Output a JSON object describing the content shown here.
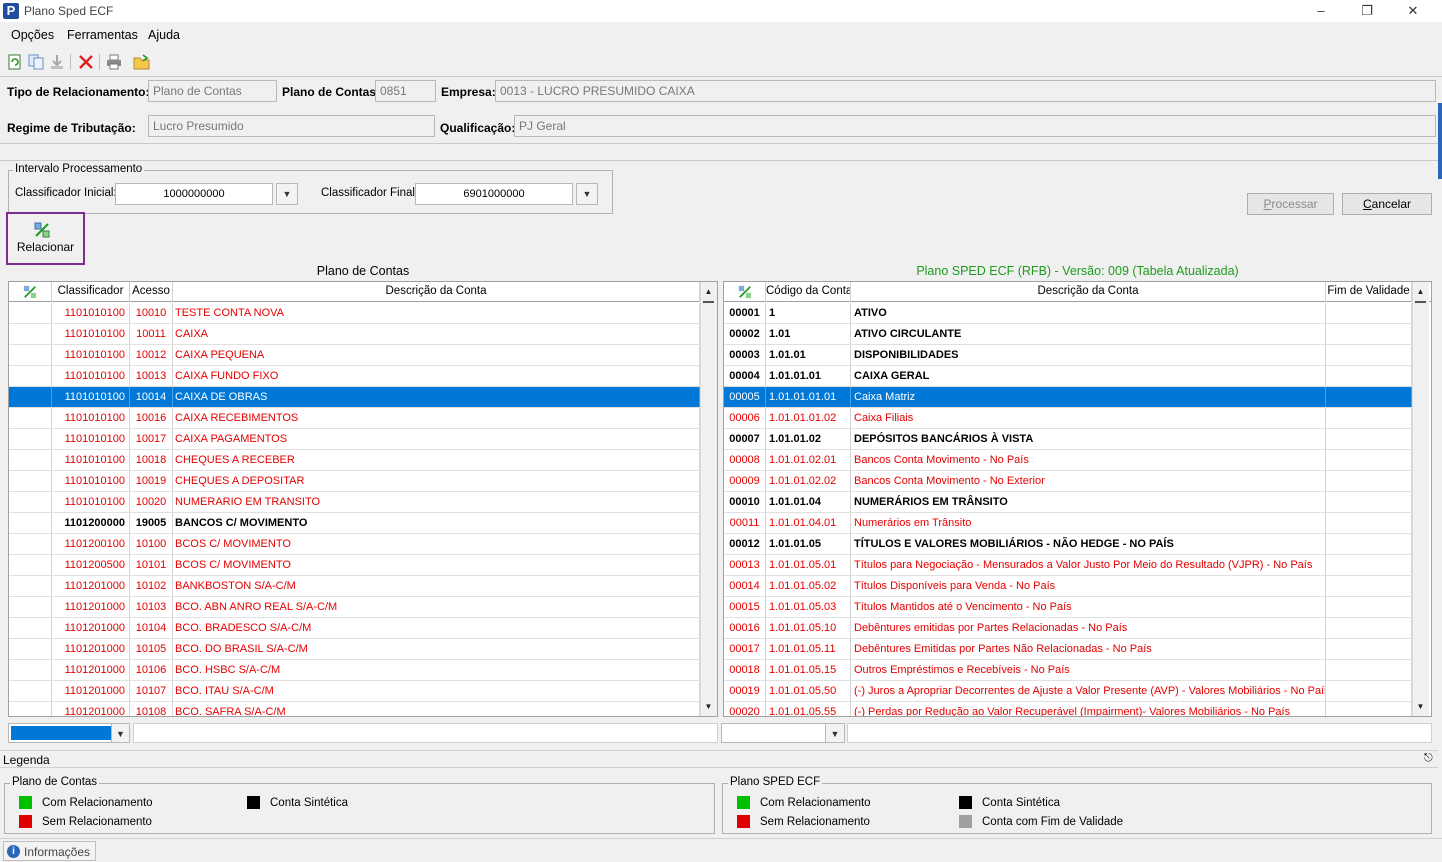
{
  "window": {
    "title": "Plano Sped ECF",
    "app_icon": "P"
  },
  "menu": [
    "Opções",
    "Ferramentas",
    "Ajuda"
  ],
  "toolbar": {
    "icons": [
      "refresh-icon",
      "copy-icon",
      "download-icon",
      "delete-icon",
      "print-icon",
      "open-folder-icon"
    ]
  },
  "form": {
    "tipo_label": "Tipo de Relacionamento:",
    "tipo_value": "Plano de Contas",
    "plano_label": "Plano de Contas:",
    "plano_value": "0851",
    "empresa_label": "Empresa:",
    "empresa_value": "0013 - LUCRO PRESUMIDO CAIXA",
    "regime_label": "Regime de Tributação:",
    "regime_value": "Lucro Presumido",
    "qualificacao_label": "Qualificação:",
    "qualificacao_value": "PJ Geral"
  },
  "intervalo": {
    "title": "Intervalo Processamento",
    "inicial_label": "Classificador Inicial:",
    "inicial_value": "1000000000",
    "final_label": "Classificador Final:",
    "final_value": "6901000000"
  },
  "buttons": {
    "processar_first": "P",
    "processar_rest": "rocessar",
    "cancelar_first": "C",
    "cancelar_rest": "ancelar",
    "relacionar": "Relacionar"
  },
  "left_grid": {
    "caption": "Plano de Contas",
    "headers": [
      "Classificador",
      "Acesso",
      "Descrição da Conta"
    ],
    "rows": [
      {
        "c": "1101010100",
        "a": "10010",
        "d": "TESTE CONTA NOVA",
        "t": "red"
      },
      {
        "c": "1101010100",
        "a": "10011",
        "d": "CAIXA",
        "t": "red"
      },
      {
        "c": "1101010100",
        "a": "10012",
        "d": "CAIXA PEQUENA",
        "t": "red"
      },
      {
        "c": "1101010100",
        "a": "10013",
        "d": "CAIXA FUNDO FIXO",
        "t": "red"
      },
      {
        "c": "1101010100",
        "a": "10014",
        "d": "CAIXA DE OBRAS",
        "t": "sel"
      },
      {
        "c": "1101010100",
        "a": "10016",
        "d": "CAIXA RECEBIMENTOS",
        "t": "red"
      },
      {
        "c": "1101010100",
        "a": "10017",
        "d": "CAIXA PAGAMENTOS",
        "t": "red"
      },
      {
        "c": "1101010100",
        "a": "10018",
        "d": "CHEQUES A RECEBER",
        "t": "red"
      },
      {
        "c": "1101010100",
        "a": "10019",
        "d": "CHEQUES A DEPOSITAR",
        "t": "red"
      },
      {
        "c": "1101010100",
        "a": "10020",
        "d": "NUMERARIO EM TRANSITO",
        "t": "red"
      },
      {
        "c": "1101200000",
        "a": "19005",
        "d": "BANCOS C/ MOVIMENTO",
        "t": "blk"
      },
      {
        "c": "1101200100",
        "a": "10100",
        "d": "BCOS C/ MOVIMENTO",
        "t": "red"
      },
      {
        "c": "1101200500",
        "a": "10101",
        "d": "BCOS C/ MOVIMENTO",
        "t": "red"
      },
      {
        "c": "1101201000",
        "a": "10102",
        "d": "BANKBOSTON S/A-C/M",
        "t": "red"
      },
      {
        "c": "1101201000",
        "a": "10103",
        "d": "BCO. ABN ANRO REAL S/A-C/M",
        "t": "red"
      },
      {
        "c": "1101201000",
        "a": "10104",
        "d": "BCO. BRADESCO S/A-C/M",
        "t": "red"
      },
      {
        "c": "1101201000",
        "a": "10105",
        "d": "BCO. DO BRASIL S/A-C/M",
        "t": "red"
      },
      {
        "c": "1101201000",
        "a": "10106",
        "d": "BCO. HSBC S/A-C/M",
        "t": "red"
      },
      {
        "c": "1101201000",
        "a": "10107",
        "d": "BCO. ITAU S/A-C/M",
        "t": "red"
      },
      {
        "c": "1101201000",
        "a": "10108",
        "d": "BCO. SAFRA S/A-C/M",
        "t": "red"
      }
    ]
  },
  "right_grid": {
    "caption": "Plano SPED ECF (RFB) - Versão: 009 (Tabela Atualizada)",
    "caption_color": "#1f9a1f",
    "headers": [
      "Código da Conta",
      "Descrição da Conta",
      "Fim de Validade"
    ],
    "rows": [
      {
        "n": "00001",
        "c": "1",
        "d": "ATIVO",
        "t": "blk"
      },
      {
        "n": "00002",
        "c": "1.01",
        "d": "ATIVO CIRCULANTE",
        "t": "blk"
      },
      {
        "n": "00003",
        "c": "1.01.01",
        "d": "DISPONIBILIDADES",
        "t": "blk"
      },
      {
        "n": "00004",
        "c": "1.01.01.01",
        "d": "CAIXA GERAL",
        "t": "blk"
      },
      {
        "n": "00005",
        "c": "1.01.01.01.01",
        "d": "Caixa Matriz",
        "t": "sel"
      },
      {
        "n": "00006",
        "c": "1.01.01.01.02",
        "d": "Caixa Filiais",
        "t": "red"
      },
      {
        "n": "00007",
        "c": "1.01.01.02",
        "d": "DEPÓSITOS BANCÁRIOS À VISTA",
        "t": "blk"
      },
      {
        "n": "00008",
        "c": "1.01.01.02.01",
        "d": "Bancos Conta Movimento - No País",
        "t": "red"
      },
      {
        "n": "00009",
        "c": "1.01.01.02.02",
        "d": "Bancos Conta Movimento - No Exterior",
        "t": "red"
      },
      {
        "n": "00010",
        "c": "1.01.01.04",
        "d": "NUMERÁRIOS EM TRÂNSITO",
        "t": "blk"
      },
      {
        "n": "00011",
        "c": "1.01.01.04.01",
        "d": "Numerários em Trânsito",
        "t": "red"
      },
      {
        "n": "00012",
        "c": "1.01.01.05",
        "d": "TÍTULOS E VALORES MOBILIÁRIOS - NÃO HEDGE - NO PAÍS",
        "t": "blk"
      },
      {
        "n": "00013",
        "c": "1.01.01.05.01",
        "d": "Títulos para Negociação - Mensurados a Valor Justo Por Meio do Resultado (VJPR) - No País",
        "t": "red"
      },
      {
        "n": "00014",
        "c": "1.01.01.05.02",
        "d": "Títulos Disponíveis para Venda - No País",
        "t": "red"
      },
      {
        "n": "00015",
        "c": "1.01.01.05.03",
        "d": "Títulos Mantidos até o Vencimento - No País",
        "t": "red"
      },
      {
        "n": "00016",
        "c": "1.01.01.05.10",
        "d": "Debêntures emitidas por Partes Relacionadas - No País",
        "t": "red"
      },
      {
        "n": "00017",
        "c": "1.01.01.05.11",
        "d": "Debêntures Emitidas por Partes Não Relacionadas - No País",
        "t": "red"
      },
      {
        "n": "00018",
        "c": "1.01.01.05.15",
        "d": "Outros Empréstimos e Recebíveis - No País",
        "t": "red"
      },
      {
        "n": "00019",
        "c": "1.01.01.05.50",
        "d": "(-) Juros a Apropriar Decorrentes de Ajuste a Valor Presente (AVP) -  Valores Mobiliários - No País",
        "t": "red"
      },
      {
        "n": "00020",
        "c": "1.01.01.05.55",
        "d": "(-) Perdas por Redução ao Valor Recuperável (Impairment)- Valores Mobiliários - No País",
        "t": "red"
      }
    ]
  },
  "legend": {
    "title": "Legenda",
    "left_title": "Plano de Contas",
    "left_items": [
      {
        "label": "Com Relacionamento",
        "color": "#00c000"
      },
      {
        "label": "Sem Relacionamento",
        "color": "#e00000"
      },
      {
        "label": "Conta Sintética",
        "color": "#000000"
      }
    ],
    "right_title": "Plano SPED ECF",
    "right_items": [
      {
        "label": "Com Relacionamento",
        "color": "#00c000"
      },
      {
        "label": "Sem Relacionamento",
        "color": "#e00000"
      },
      {
        "label": "Conta Sintética",
        "color": "#000000"
      },
      {
        "label": "Conta com Fim de Validade",
        "color": "#a0a0a0"
      }
    ]
  },
  "status": {
    "info_label": "Informações"
  },
  "colors": {
    "selection": "#0078d7",
    "red_text": "#e60000",
    "relacionar_border": "#7a2f8f"
  }
}
